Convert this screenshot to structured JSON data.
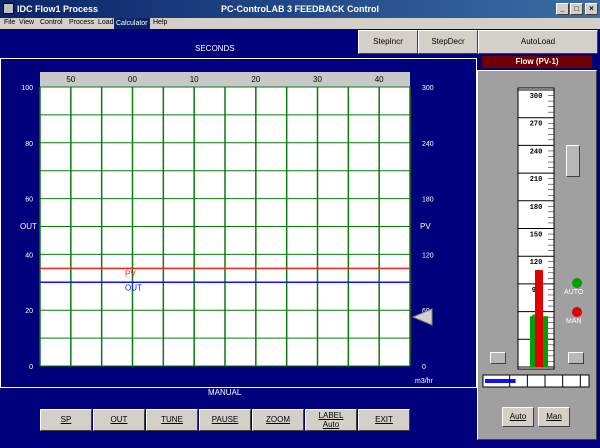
{
  "window": {
    "app_title": "IDC Flow1 Process",
    "center_title": "PC-ControLAB 3 FEEDBACK Control",
    "minimize": "_",
    "maximize": "□",
    "close": "×"
  },
  "menu": {
    "file": "File",
    "view": "View",
    "control": "Control",
    "process": "Process",
    "load": "Load",
    "calculator": "Calculator",
    "help": "Help"
  },
  "toolbar": {
    "step_incr": "StepIncr",
    "step_decr": "StepDecr",
    "auto_load": "AutoLoad"
  },
  "chart_data": {
    "type": "line",
    "xlabel": "SECONDS",
    "x_ticks": [
      "50",
      "00",
      "10",
      "20",
      "30",
      "40"
    ],
    "left_axis": {
      "label": "OUT",
      "ticks": [
        "100",
        "80",
        "60",
        "40",
        "20",
        "0"
      ],
      "ylim": [
        0,
        100
      ]
    },
    "right_axis": {
      "label": "PV",
      "unit": "m3/hr",
      "ticks": [
        "300",
        "240",
        "180",
        "120",
        "60",
        "0"
      ],
      "ylim": [
        0,
        300
      ]
    },
    "series": [
      {
        "name": "PV",
        "color": "#ff2020",
        "value": 105,
        "axis": "right"
      },
      {
        "name": "OUT",
        "color": "#1010ff",
        "value": 30,
        "axis": "left"
      }
    ],
    "grid": true,
    "mode_label": "MANUAL"
  },
  "buttons": {
    "sp": "SP",
    "out": "OUT",
    "tune": "TUNE",
    "pause": "PAUSE",
    "zoom": "ZOOM",
    "label_line1": "LABEL",
    "label_line2": "Auto",
    "exit": "EXIT"
  },
  "faceplate": {
    "title": "Flow  (PV-1)",
    "scale": [
      "300",
      "270",
      "240",
      "210",
      "180",
      "150",
      "120",
      "90",
      "60",
      "30",
      "0"
    ],
    "scale_max": 300,
    "pv_value": 105,
    "sp_value": 55,
    "out_percent": 30,
    "auto_label": "AUTO",
    "man_label": "MAN",
    "auto_button": "Auto",
    "man_button": "Man",
    "colors": {
      "pv_bar": "#e00000",
      "sp_bar": "#00a000",
      "auto_lamp": "#00a000",
      "man_lamp": "#e00000"
    }
  }
}
